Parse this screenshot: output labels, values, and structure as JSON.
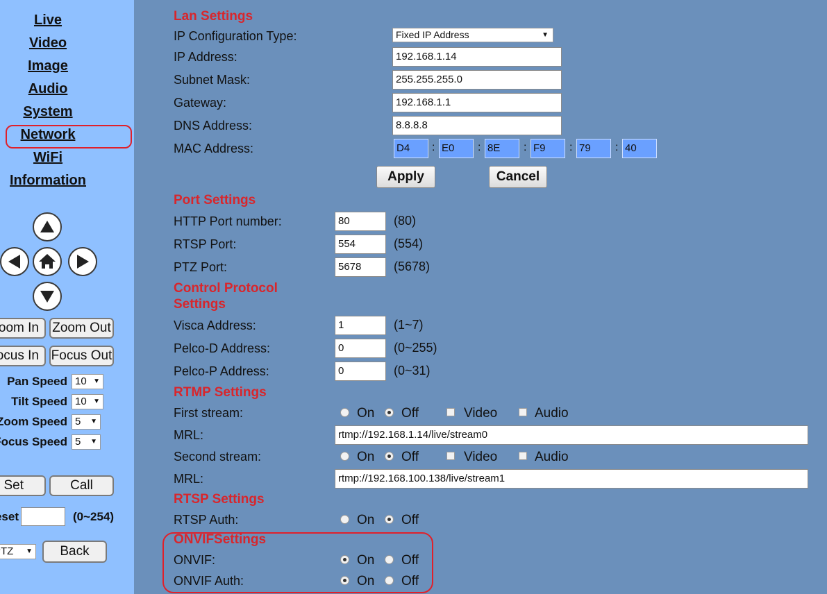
{
  "sidebar": {
    "nav": [
      "Live",
      "Video",
      "Image",
      "Audio",
      "System",
      "Network",
      "WiFi",
      "Information"
    ],
    "active_item": "Network",
    "zoom_in": "Zoom In",
    "zoom_out": "Zoom Out",
    "focus_in": "Focus In",
    "focus_out": "Focus Out",
    "pan_speed_label": "Pan Speed",
    "pan_speed_value": "10",
    "tilt_speed_label": "Tilt Speed",
    "tilt_speed_value": "10",
    "zoom_speed_label": "Zoom Speed",
    "zoom_speed_value": "5",
    "focus_speed_label": "Focus Speed",
    "focus_speed_value": "5",
    "set_button": "Set",
    "call_button": "Call",
    "preset_label": "Preset",
    "preset_value": "",
    "preset_range": "(0~254)",
    "mode_select": "PTZ",
    "back_button": "Back"
  },
  "lan": {
    "title": "Lan Settings",
    "ip_config_label": "IP Configuration Type:",
    "ip_config_value": "Fixed IP Address",
    "ip_label": "IP Address:",
    "ip_value": "192.168.1.14",
    "subnet_label": "Subnet Mask:",
    "subnet_value": "255.255.255.0",
    "gateway_label": "Gateway:",
    "gateway_value": "192.168.1.1",
    "dns_label": "DNS Address:",
    "dns_value": "8.8.8.8",
    "mac_label": "MAC Address:",
    "mac": [
      "D4",
      "E0",
      "8E",
      "F9",
      "79",
      "40"
    ],
    "apply": "Apply",
    "cancel": "Cancel"
  },
  "ports": {
    "title": "Port Settings",
    "http_label": "HTTP Port number:",
    "http_value": "80",
    "http_default": "(80)",
    "rtsp_label": "RTSP Port:",
    "rtsp_value": "554",
    "rtsp_default": "(554)",
    "ptz_label": "PTZ Port:",
    "ptz_value": "5678",
    "ptz_default": "(5678)"
  },
  "control": {
    "title_line1": "Control Protocol",
    "title_line2": "Settings",
    "visca_label": "Visca Address:",
    "visca_value": "1",
    "visca_range": "(1~7)",
    "pelcod_label": "Pelco-D Address:",
    "pelcod_value": "0",
    "pelcod_range": "(0~255)",
    "pelcop_label": "Pelco-P Address:",
    "pelcop_value": "0",
    "pelcop_range": "(0~31)"
  },
  "rtmp": {
    "title": "RTMP Settings",
    "first_label": "First stream:",
    "first_state": "Off",
    "mrl_label": "MRL:",
    "mrl1": "rtmp://192.168.1.14/live/stream0",
    "second_label": "Second stream:",
    "second_state": "Off",
    "mrl2": "rtmp://192.168.100.138/live/stream1",
    "on": "On",
    "off": "Off",
    "video": "Video",
    "audio": "Audio"
  },
  "rtsp": {
    "title": "RTSP Settings",
    "auth_label": "RTSP Auth:",
    "auth_state": "Off",
    "on": "On",
    "off": "Off"
  },
  "onvif": {
    "title": "ONVIFSettings",
    "onvif_label": "ONVIF:",
    "onvif_state": "On",
    "auth_label": "ONVIF Auth:",
    "auth_state": "On",
    "on": "On",
    "off": "Off"
  },
  "colors": {
    "sidebar_bg": "#8fc0ff",
    "main_bg": "#6b90bb",
    "section_title": "#d8262c",
    "highlight": "#e0202a",
    "mac_field": "#6aa0ff"
  }
}
